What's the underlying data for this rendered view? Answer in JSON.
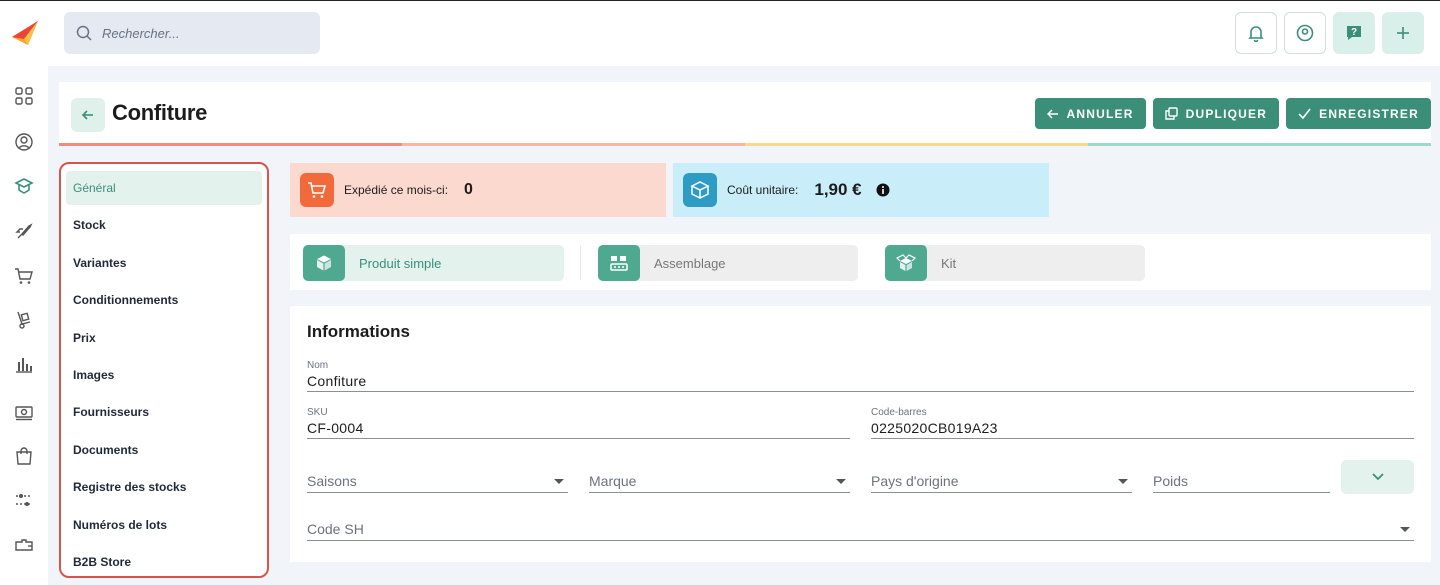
{
  "search": {
    "placeholder": "Rechercher..."
  },
  "header": {
    "title": "Confiture"
  },
  "actions": {
    "cancel": "ANNULER",
    "duplicate": "DUPLIQUER",
    "save": "ENREGISTRER"
  },
  "section_nav": [
    {
      "label": "Général",
      "active": true
    },
    {
      "label": "Stock"
    },
    {
      "label": "Variantes"
    },
    {
      "label": "Conditionnements"
    },
    {
      "label": "Prix"
    },
    {
      "label": "Images"
    },
    {
      "label": "Fournisseurs"
    },
    {
      "label": "Documents"
    },
    {
      "label": "Registre des stocks"
    },
    {
      "label": "Numéros de lots"
    },
    {
      "label": "B2B Store"
    }
  ],
  "stats": {
    "shipped_label": "Expédié ce mois-ci:",
    "shipped_value": "0",
    "unit_cost_label": "Coût unitaire:",
    "unit_cost_value": "1,90 €"
  },
  "product_types": {
    "simple": "Produit simple",
    "assembly": "Assemblage",
    "kit": "Kit"
  },
  "info": {
    "title": "Informations",
    "name_label": "Nom",
    "name_value": "Confiture",
    "sku_label": "SKU",
    "sku_value": "CF-0004",
    "barcode_label": "Code-barres",
    "barcode_value": "0225020CB019A23",
    "seasons": "Saisons",
    "brand": "Marque",
    "origin": "Pays d'origine",
    "weight": "Poids",
    "hs_code": "Code SH"
  },
  "colors": {
    "accent": "#3b8f79",
    "accent_soft": "#e3f2ec",
    "highlight_border": "#d9534a",
    "shipped_bg": "#fbd9cf",
    "shipped_icon": "#f26a3c",
    "cost_bg": "#c9eefa",
    "cost_icon": "#2d9bc4"
  }
}
